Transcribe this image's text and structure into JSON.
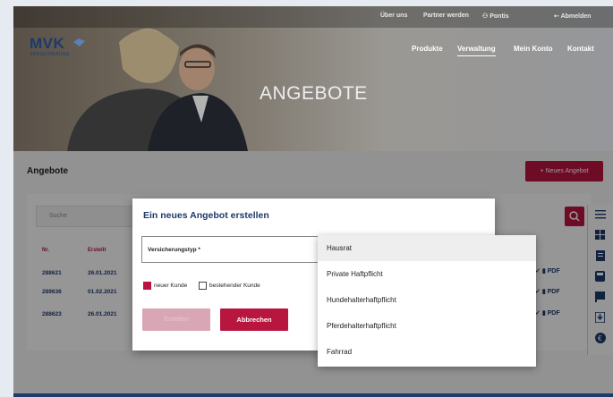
{
  "topbar": {
    "links": [
      "Über uns",
      "Partner werden",
      "Pontis",
      "Abmelden"
    ]
  },
  "logo": {
    "name": "MVK",
    "subtitle": "VERSICHERUNG"
  },
  "main_nav": [
    "Produkte",
    "Verwaltung",
    "Mein Konto",
    "Kontakt"
  ],
  "hero": {
    "title": "ANGEBOTE"
  },
  "page": {
    "title": "Angebote",
    "new_button": "+ Neues Angebot",
    "search_placeholder": "Suche"
  },
  "table": {
    "columns": [
      "Nr.",
      "Erstellt"
    ],
    "rows": [
      {
        "nr": "288621",
        "created": "26.01.2021"
      },
      {
        "nr": "289636",
        "created": "01.02.2021"
      },
      {
        "nr": "288623",
        "created": "26.01.2021"
      }
    ],
    "pdf_label": "PDF"
  },
  "modal": {
    "title": "Ein neues Angebot erstellen",
    "select_label": "Versicherungstyp *",
    "check_new": "neuer Kunde",
    "check_existing": "bestehender Kunde",
    "create_button": "Erstellen",
    "cancel_button": "Abbrechen"
  },
  "dropdown": {
    "options": [
      "Hausrat",
      "Private Haftpflicht",
      "Hundehalterhaftpflicht",
      "Pferdehalterhaftpflicht",
      "Fahrrad"
    ],
    "highlighted": "Hausrat"
  },
  "colors": {
    "brand": "#b8153f",
    "navy": "#1d3a6a"
  },
  "icons": [
    "user-icon",
    "logout-icon",
    "search-icon",
    "menu-icon",
    "grid-icon",
    "document-icon",
    "calculator-icon",
    "flag-icon",
    "download-icon",
    "euro-icon",
    "check-icon",
    "trash-icon"
  ]
}
